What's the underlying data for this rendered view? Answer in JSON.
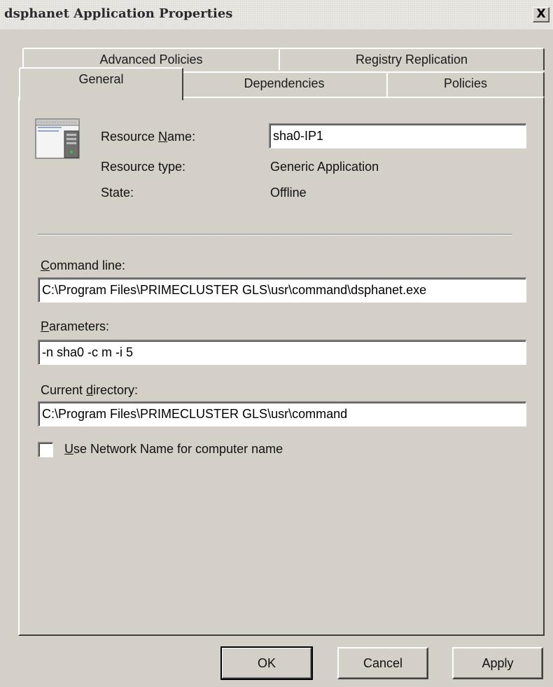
{
  "window": {
    "title": "dsphanet Application Properties",
    "close_glyph": "X"
  },
  "tabs": {
    "row_back": [
      {
        "label": "Advanced Policies"
      },
      {
        "label": "Registry Replication"
      }
    ],
    "row_front": [
      {
        "label": "General",
        "selected": true
      },
      {
        "label": "Dependencies",
        "selected": false
      },
      {
        "label": "Policies",
        "selected": false
      }
    ]
  },
  "general": {
    "icon": "cluster-resource-icon",
    "resource_name": {
      "label_pre": "Resource ",
      "label_accel": "N",
      "label_post": "ame:",
      "value": "sha0-IP1"
    },
    "resource_type": {
      "label": "Resource type:",
      "value": "Generic Application"
    },
    "state": {
      "label": "State:",
      "value": "Offline"
    },
    "command_line": {
      "label_accel": "C",
      "label_post": "ommand line:",
      "value": "C:\\Program Files\\PRIMECLUSTER GLS\\usr\\command\\dsphanet.exe"
    },
    "parameters": {
      "label_accel": "P",
      "label_post": "arameters:",
      "value": "-n sha0 -c m -i 5"
    },
    "current_directory": {
      "label_pre": "Current ",
      "label_accel": "d",
      "label_post": "irectory:",
      "value": "C:\\Program Files\\PRIMECLUSTER GLS\\usr\\command"
    },
    "use_network_name": {
      "label_accel": "U",
      "label_post": "se Network Name for computer name",
      "checked": false
    }
  },
  "buttons": {
    "ok": "OK",
    "cancel": "Cancel",
    "apply": "Apply"
  }
}
